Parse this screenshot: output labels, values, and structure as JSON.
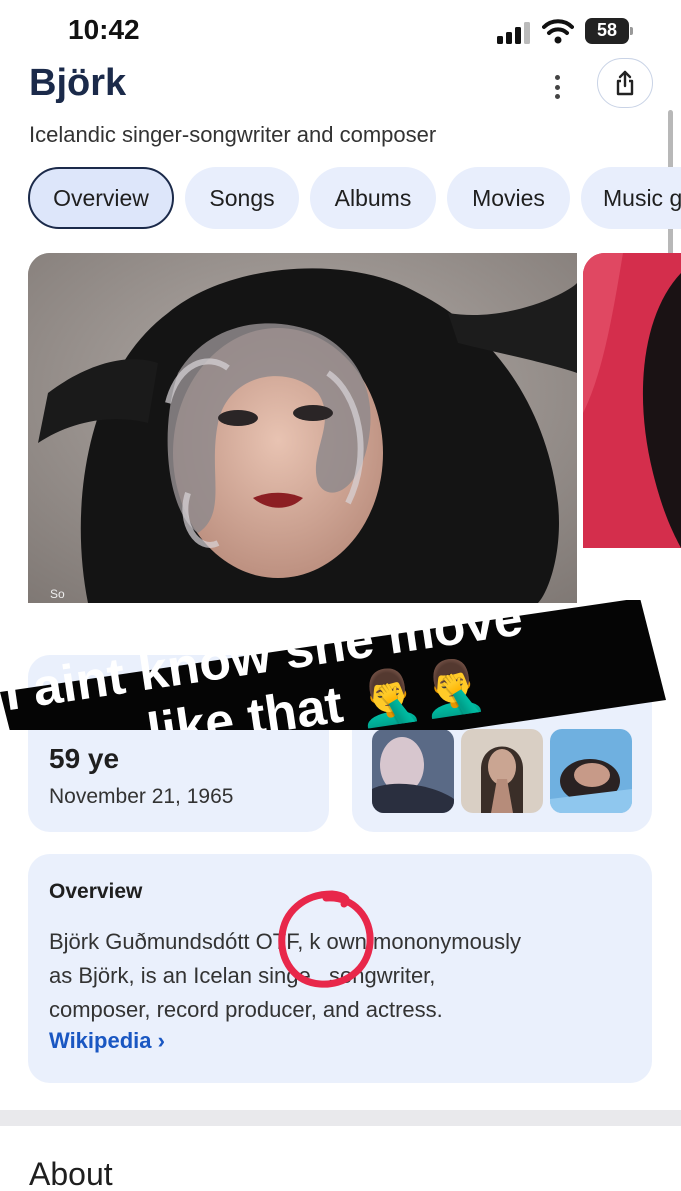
{
  "status_bar": {
    "time": "10:42",
    "battery": "58"
  },
  "header": {
    "title": "Björk",
    "subtitle": "Icelandic singer-songwriter and composer"
  },
  "tabs": [
    {
      "label": "Overview",
      "active": true
    },
    {
      "label": "Songs",
      "active": false
    },
    {
      "label": "Albums",
      "active": false
    },
    {
      "label": "Movies",
      "active": false
    },
    {
      "label": "Music g",
      "active": false
    }
  ],
  "age_card": {
    "age": "59 ye",
    "birth_date": "November 21, 1965"
  },
  "overview": {
    "heading": "Overview",
    "lines": [
      "Björk Guðmundsdótt  OTF, k  own mononymously",
      "as Björk, is an Icelan    singe , songwriter,",
      "composer, record producer, and actress."
    ],
    "link": "Wikipedia ›"
  },
  "about": {
    "heading": "About"
  },
  "overlay": {
    "caption_line_1": "I aint know she move",
    "caption_line_2": "like that 🤦‍♂️🤦‍♂️"
  },
  "colors": {
    "accent": "#1b2a4a",
    "card": "#eaf0fc",
    "link": "#1a57c2",
    "annotation": "#e8274a"
  }
}
